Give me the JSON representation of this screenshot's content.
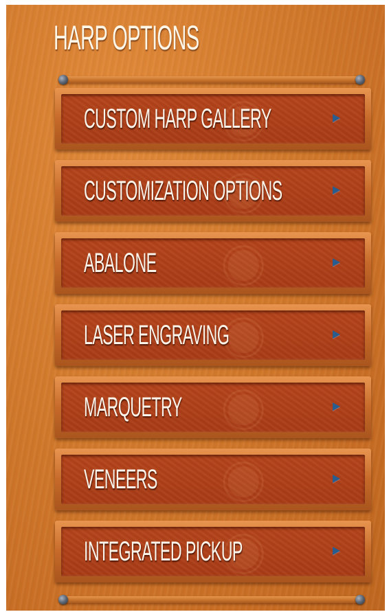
{
  "sidebar": {
    "title": "HARP OPTIONS",
    "items": [
      {
        "label": "CUSTOM HARP GALLERY",
        "icon": "chevron-right-icon"
      },
      {
        "label": "CUSTOMIZATION OPTIONS",
        "icon": "chevron-right-icon"
      },
      {
        "label": "ABALONE",
        "icon": "chevron-right-icon"
      },
      {
        "label": "LASER ENGRAVING",
        "icon": "chevron-right-icon"
      },
      {
        "label": "MARQUETRY",
        "icon": "chevron-right-icon"
      },
      {
        "label": "VENEERS",
        "icon": "chevron-right-icon"
      },
      {
        "label": "INTEGRATED PICKUP",
        "icon": "chevron-right-icon"
      }
    ]
  },
  "colors": {
    "panel_wood": "#d27a2c",
    "button_inset": "#b0401a",
    "label_text": "#fbf4ea",
    "arrow": "#2a5d8f"
  }
}
